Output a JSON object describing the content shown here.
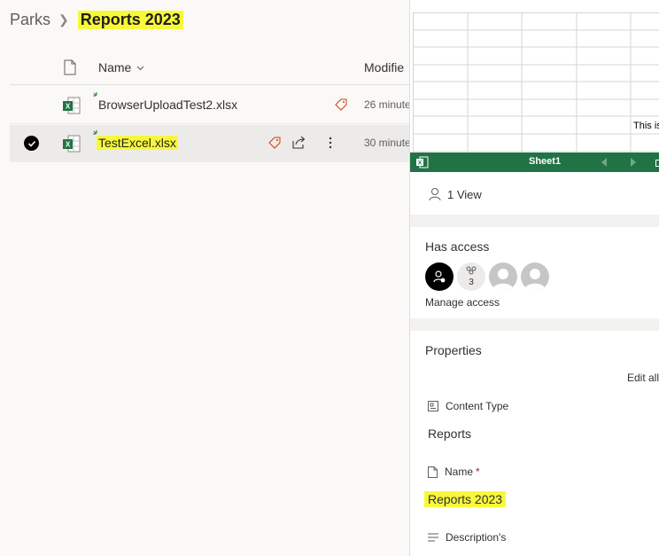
{
  "breadcrumb": {
    "parent": "Parks",
    "current": "Reports 2023"
  },
  "list": {
    "columns": {
      "name": "Name",
      "modified": "Modifie"
    },
    "rows": [
      {
        "name": "BrowserUploadTest2.xlsx",
        "modified": "26 minute",
        "selected": false
      },
      {
        "name": "TestExcel.xlsx",
        "modified": "30 minute",
        "selected": true
      }
    ]
  },
  "preview": {
    "cell_text": "This is",
    "sheet_name": "Sheet1"
  },
  "details": {
    "views": "1 View",
    "access": {
      "title": "Has access",
      "group_count": "3",
      "manage_label": "Manage access"
    },
    "properties": {
      "title": "Properties",
      "edit_all": "Edit all",
      "content_type_label": "Content Type",
      "content_type_value": "Reports",
      "name_label": "Name",
      "name_required": "*",
      "name_value": "Reports 2023",
      "description_label": "Description's"
    }
  },
  "colors": {
    "highlight": "#f8f83a",
    "excel_green": "#217346",
    "selected_row": "#edebe9",
    "tag_orange": "#d83b01"
  },
  "icons": [
    "chevron-right-icon",
    "file-icon",
    "chevron-down-icon",
    "excel-file-icon",
    "checkmark-icon",
    "tag-icon",
    "share-icon",
    "more-icon",
    "person-icon",
    "group-icon",
    "content-type-icon",
    "document-icon",
    "text-lines-icon"
  ]
}
